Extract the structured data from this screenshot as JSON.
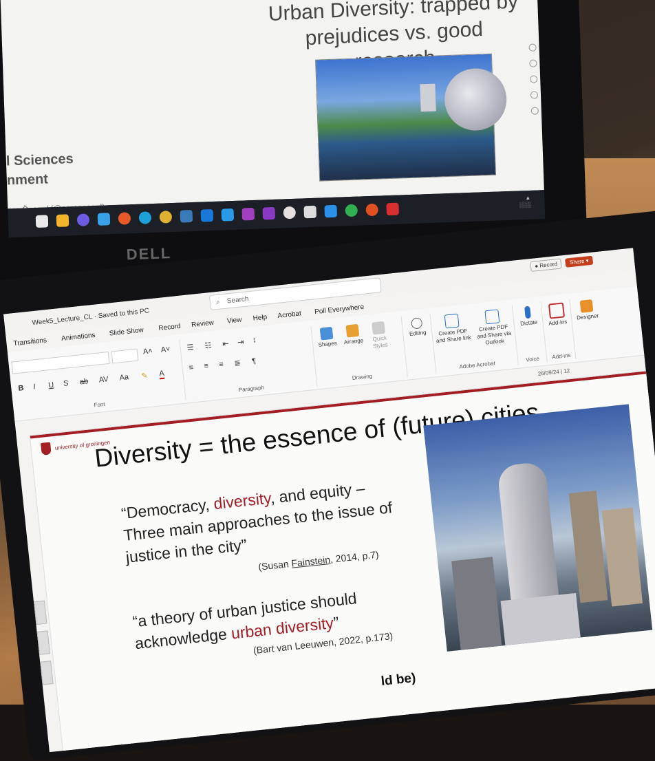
{
  "monitor": {
    "title": "Urban Diversity: trapped by prejudices vs. good research",
    "left_line1": "l Sciences",
    "left_line2": "nment",
    "credit": "ara Özogul (@saraozogul)",
    "brand": "DELL"
  },
  "titlebar": {
    "filename": "Week5_Lecture_CL · Saved to this PC",
    "search_placeholder": "Search",
    "record": "Record",
    "share": "Share"
  },
  "tabs": [
    "Transitions",
    "Animations",
    "Slide Show",
    "Record",
    "Review",
    "View",
    "Help",
    "Acrobat",
    "Poll Everywhere"
  ],
  "ribbon": {
    "font_label": "Font",
    "paragraph_label": "Paragraph",
    "drawing_label": "Drawing",
    "adobe_label": "Adobe Acrobat",
    "voice_label": "Voice",
    "addins_label": "Add-ins",
    "shapes": "Shapes",
    "arrange": "Arrange",
    "quick_styles": "Quick Styles",
    "editing": "Editing",
    "create_pdf_share": "Create PDF and Share link",
    "create_pdf_outlook": "Create PDF and Share via Outlook",
    "dictate": "Dictate",
    "addins": "Add-ins",
    "designer": "Designer",
    "bold": "B",
    "italic": "I",
    "underline": "U",
    "strike": "S"
  },
  "date_page": "26/09/24 | 12",
  "slide": {
    "logo": "university of groningen",
    "title": "Diversity = the essence of (future) cities",
    "q1_pre": "“Democracy, ",
    "q1_red": "diversity",
    "q1_post": ", and equity – Three main approaches to the issue of justice in the city”",
    "cite1_pre": "(Susan ",
    "cite1_ul": "Fainstein",
    "cite1_post": ", 2014, p.7)",
    "q2_pre": "“a theory of urban justice should acknowledge ",
    "q2_red": "urban diversity",
    "q2_post": "”",
    "cite2": "(Bart van Leeuwen, 2022, p.173)",
    "q3": "ld be)"
  }
}
